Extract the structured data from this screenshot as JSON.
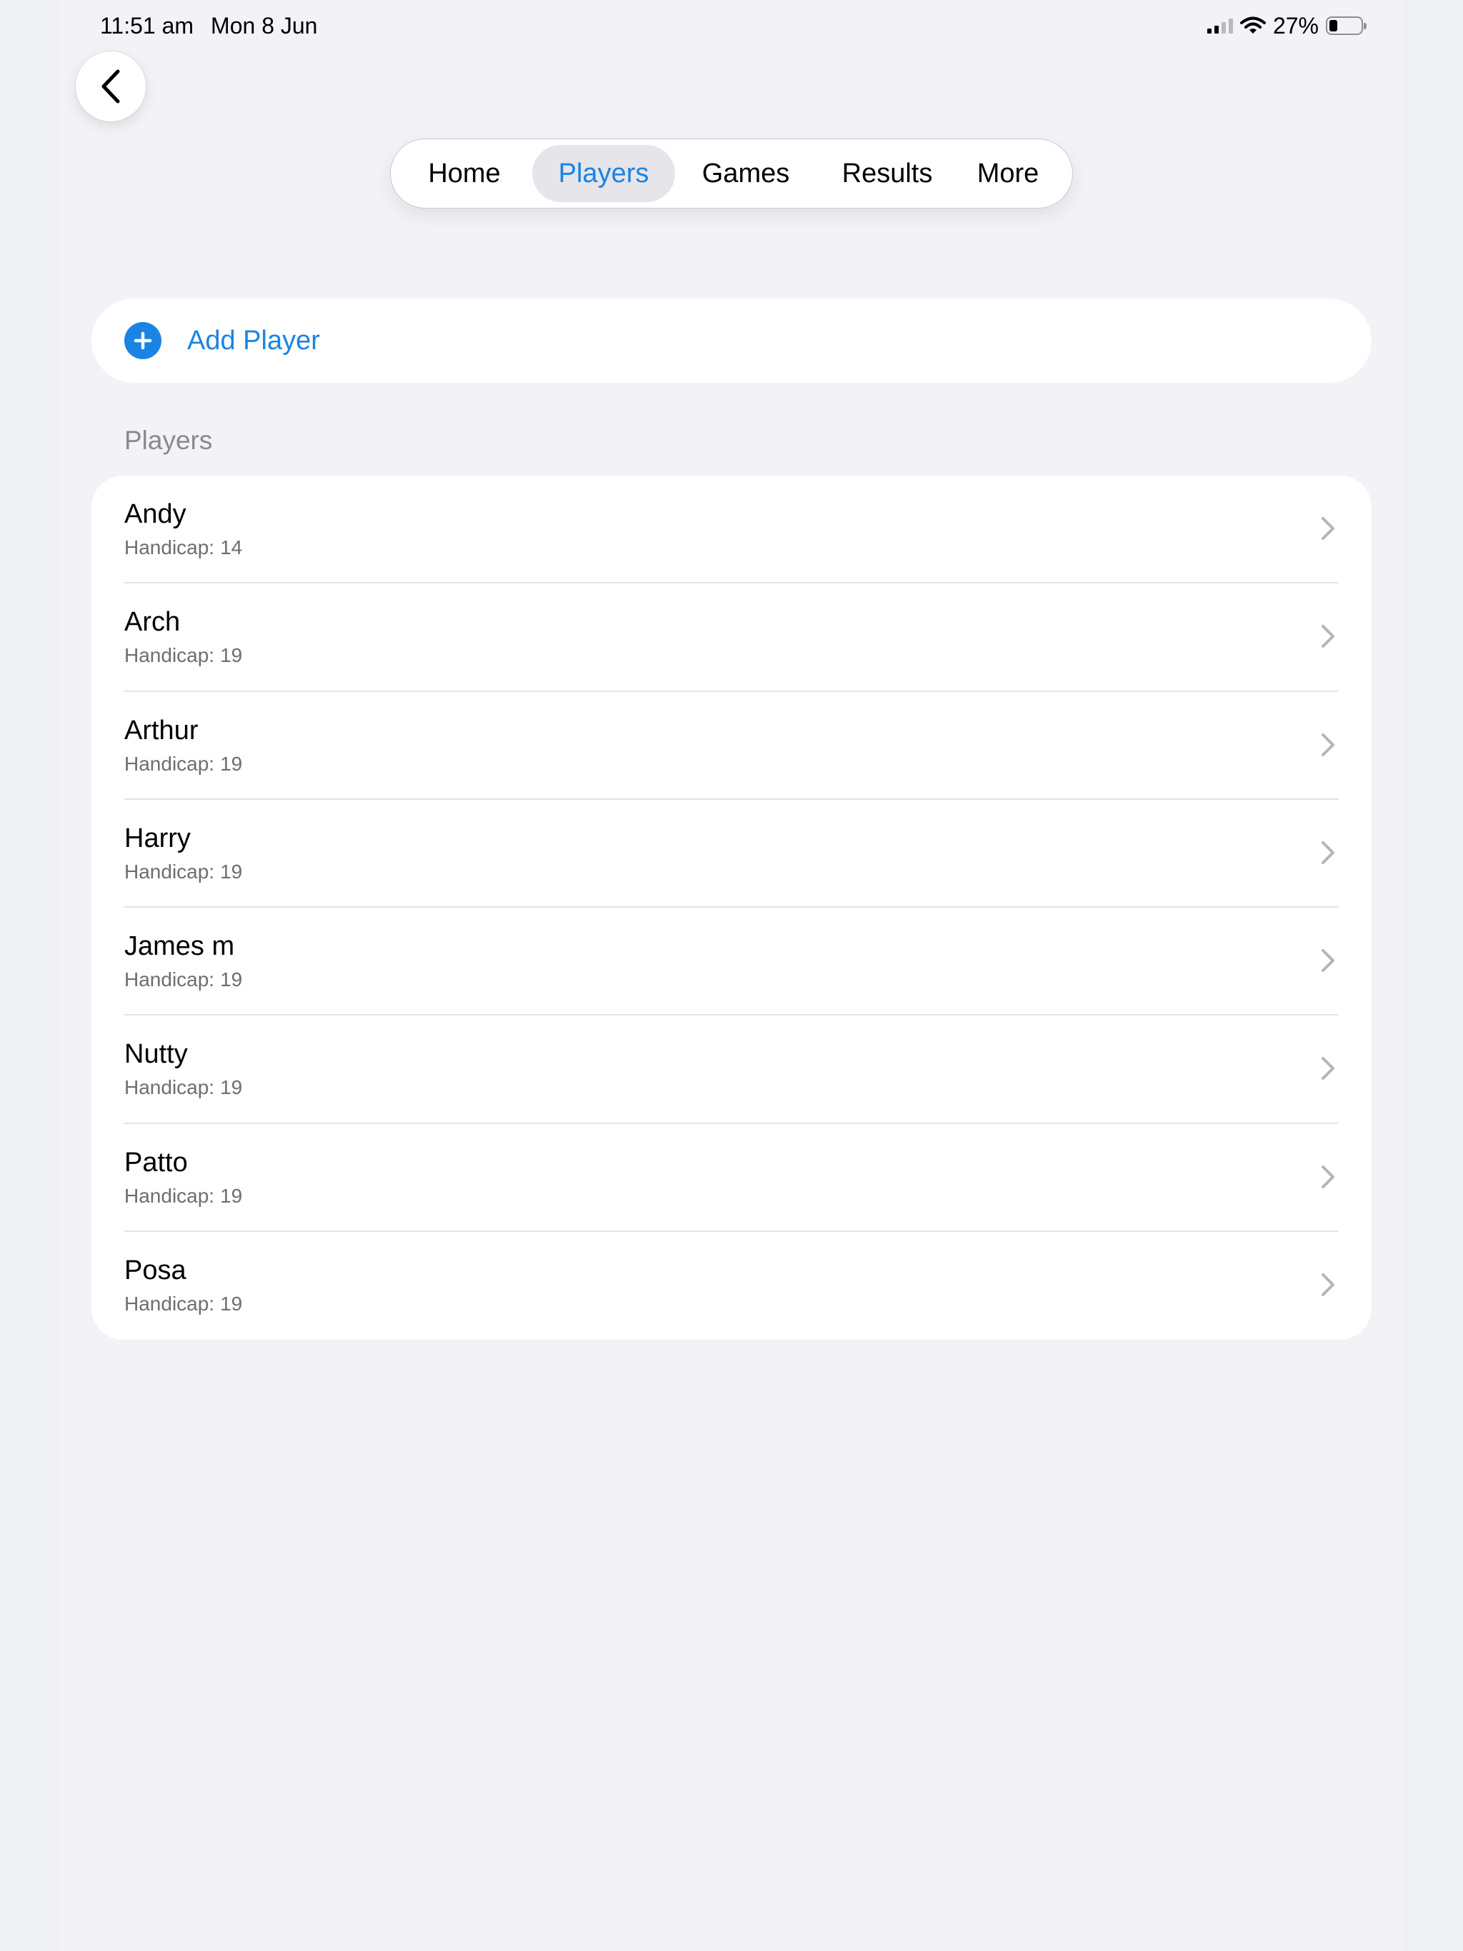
{
  "status_bar": {
    "time": "11:51 am",
    "date": "Mon 8 Jun",
    "battery": "27%",
    "battery_level": 0.27
  },
  "tabs": [
    {
      "label": "Home",
      "active": false
    },
    {
      "label": "Players",
      "active": true
    },
    {
      "label": "Games",
      "active": false
    },
    {
      "label": "Results",
      "active": false
    },
    {
      "label": "More",
      "active": false
    }
  ],
  "add_player": {
    "label": "Add Player"
  },
  "section": {
    "title": "Players"
  },
  "handicap_label": "Handicap:",
  "players": [
    {
      "name": "Andy",
      "handicap": "14"
    },
    {
      "name": "Arch",
      "handicap": "19"
    },
    {
      "name": "Arthur",
      "handicap": "19"
    },
    {
      "name": "Harry",
      "handicap": "19"
    },
    {
      "name": "James m",
      "handicap": "19"
    },
    {
      "name": "Nutty",
      "handicap": "19"
    },
    {
      "name": "Patto",
      "handicap": "19"
    },
    {
      "name": "Posa",
      "handicap": "19"
    }
  ],
  "colors": {
    "accent": "#1a84e4",
    "background": "#f2f2f7",
    "card": "#ffffff",
    "secondary_text": "#6d6d72"
  }
}
